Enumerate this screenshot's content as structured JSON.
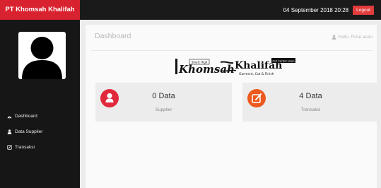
{
  "app": {
    "brand": "PT Khomsah Khalifah"
  },
  "topbar": {
    "datetime": "04 September 2018 20:28",
    "logout_label": "Logout"
  },
  "sidebar": {
    "items": [
      {
        "label": "Dashboard",
        "icon": "dashboard-icon"
      },
      {
        "label": "Data Supplier",
        "icon": "user-icon"
      },
      {
        "label": "Transaksi",
        "icon": "transaction-icon"
      }
    ]
  },
  "main": {
    "title": "Dashboard",
    "greeting": "Hallo, Rizal asan",
    "logo": {
      "left_text": "Khomsah",
      "small_text": "Smart High",
      "right_text": "Khalifah",
      "right_sub": "Garment, Cut & Finish",
      "badge": "Cut Center Jalan"
    },
    "cards": [
      {
        "value": "0 Data",
        "label": "Supplier",
        "color": "#e02a3c",
        "icon": "user-icon"
      },
      {
        "value": "4 Data",
        "label": "Transaksi",
        "color": "#ec5a1f",
        "icon": "edit-icon"
      }
    ]
  },
  "colors": {
    "brand": "#d9222f",
    "topbar": "#1a1a1a",
    "sidebar": "#161616"
  }
}
